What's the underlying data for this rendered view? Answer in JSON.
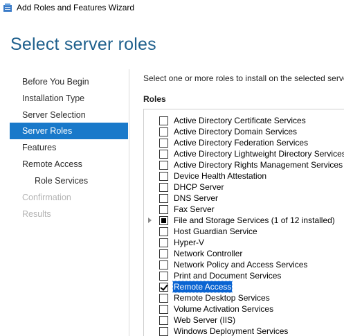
{
  "window": {
    "title": "Add Roles and Features Wizard"
  },
  "page_title": "Select server roles",
  "nav": {
    "items": [
      {
        "label": "Before You Begin",
        "state": "normal"
      },
      {
        "label": "Installation Type",
        "state": "normal"
      },
      {
        "label": "Server Selection",
        "state": "normal"
      },
      {
        "label": "Server Roles",
        "state": "selected"
      },
      {
        "label": "Features",
        "state": "normal"
      },
      {
        "label": "Remote Access",
        "state": "normal"
      },
      {
        "label": "Role Services",
        "state": "sub"
      },
      {
        "label": "Confirmation",
        "state": "disabled"
      },
      {
        "label": "Results",
        "state": "disabled"
      }
    ]
  },
  "content": {
    "instruction": "Select one or more roles to install on the selected serve",
    "roles_heading": "Roles",
    "roles": [
      {
        "label": "Active Directory Certificate Services",
        "state": "unchecked"
      },
      {
        "label": "Active Directory Domain Services",
        "state": "unchecked"
      },
      {
        "label": "Active Directory Federation Services",
        "state": "unchecked"
      },
      {
        "label": "Active Directory Lightweight Directory Services",
        "state": "unchecked"
      },
      {
        "label": "Active Directory Rights Management Services",
        "state": "unchecked"
      },
      {
        "label": "Device Health Attestation",
        "state": "unchecked"
      },
      {
        "label": "DHCP Server",
        "state": "unchecked"
      },
      {
        "label": "DNS Server",
        "state": "unchecked"
      },
      {
        "label": "Fax Server",
        "state": "unchecked"
      },
      {
        "label": "File and Storage Services (1 of 12 installed)",
        "state": "partial",
        "expandable": true
      },
      {
        "label": "Host Guardian Service",
        "state": "unchecked"
      },
      {
        "label": "Hyper-V",
        "state": "unchecked"
      },
      {
        "label": "Network Controller",
        "state": "unchecked"
      },
      {
        "label": "Network Policy and Access Services",
        "state": "unchecked"
      },
      {
        "label": "Print and Document Services",
        "state": "unchecked"
      },
      {
        "label": "Remote Access",
        "state": "checked",
        "selected": true
      },
      {
        "label": "Remote Desktop Services",
        "state": "unchecked"
      },
      {
        "label": "Volume Activation Services",
        "state": "unchecked"
      },
      {
        "label": "Web Server (IIS)",
        "state": "unchecked"
      },
      {
        "label": "Windows Deployment Services",
        "state": "unchecked"
      }
    ]
  },
  "icons": {
    "app": "server-manager-icon",
    "expander": "expand-triangle-icon"
  },
  "colors": {
    "title_blue": "#1e5f8c",
    "nav_selected": "#1979ca",
    "item_selected": "#0a64d2"
  }
}
